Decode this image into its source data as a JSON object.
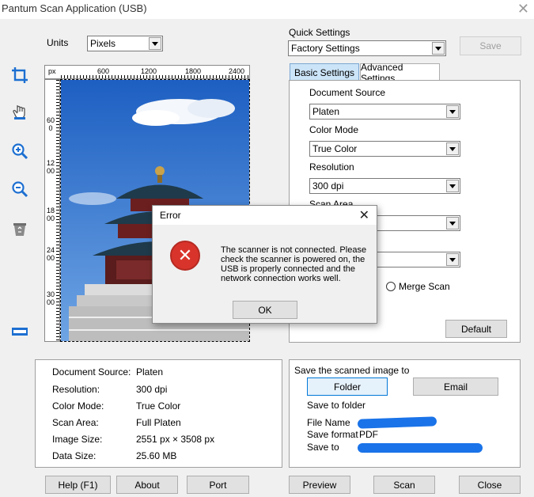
{
  "window": {
    "title": "Pantum Scan Application (USB)",
    "close_glyph": "✕"
  },
  "units": {
    "label": "Units",
    "value": "Pixels"
  },
  "quick_settings": {
    "label": "Quick Settings",
    "value": "Factory Settings",
    "save_label": "Save"
  },
  "tabs": [
    {
      "label": "Basic Settings"
    },
    {
      "label": "Advanced Settings"
    }
  ],
  "basic": {
    "document_source_label": "Document Source",
    "document_source_value": "Platen",
    "color_mode_label": "Color Mode",
    "color_mode_value": "True Color",
    "resolution_label": "Resolution",
    "resolution_value": "300 dpi",
    "scan_area_label": "Scan Area",
    "merge_scan_label": "Merge Scan",
    "default_label": "Default"
  },
  "ruler": {
    "unit": "px",
    "top_ticks": [
      "600",
      "1200",
      "1800",
      "2400"
    ],
    "left_ticks": [
      "600",
      "1200",
      "1800",
      "2400",
      "3000"
    ]
  },
  "toolbar": {
    "tools": [
      {
        "name": "crop-icon"
      },
      {
        "name": "hand-icon"
      },
      {
        "name": "zoom-in-icon"
      },
      {
        "name": "zoom-out-icon"
      },
      {
        "name": "recycle-bin-icon"
      },
      {
        "name": "fit-page-icon"
      }
    ]
  },
  "info": {
    "rows": [
      {
        "label": "Document Source:",
        "value": "Platen"
      },
      {
        "label": "Resolution:",
        "value": "300 dpi"
      },
      {
        "label": "Color Mode:",
        "value": "True Color"
      },
      {
        "label": "Scan Area:",
        "value": "Full Platen"
      },
      {
        "label": "Image Size:",
        "value": "2551 px × 3508 px"
      },
      {
        "label": "Data Size:",
        "value": "25.60 MB"
      }
    ]
  },
  "save_section": {
    "title": "Save the scanned image to",
    "folder_label": "Folder",
    "email_label": "Email",
    "save_to_folder": "Save to folder",
    "file_name_label": "File Name",
    "save_format_label": "Save format",
    "save_format_value": "PDF",
    "save_to_label": "Save to"
  },
  "bottom": {
    "help_label": "Help (F1)",
    "about_label": "About",
    "port_label": "Port",
    "preview_label": "Preview",
    "scan_label": "Scan",
    "close_label": "Close"
  },
  "error_dialog": {
    "title": "Error",
    "close_glyph": "✕",
    "message": "The scanner is not connected. Please check the scanner is powered on, the USB is properly connected and the network connection works well.",
    "ok_label": "OK",
    "icon_glyph": "✕"
  },
  "colors": {
    "accent": "#0078d7",
    "tab_active": "#cce4f7",
    "error_red": "#d9342b",
    "redaction": "#1a73e8"
  }
}
